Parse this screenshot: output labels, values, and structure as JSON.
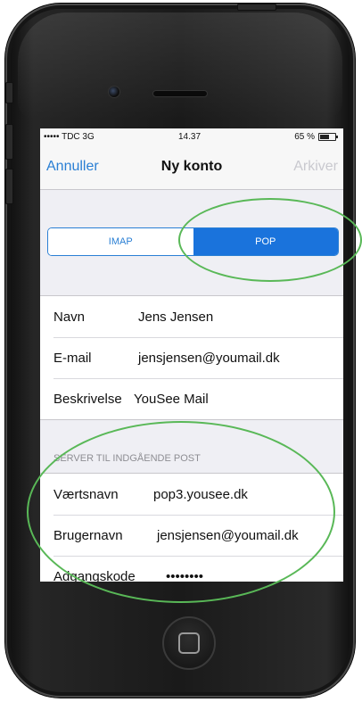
{
  "status_bar": {
    "carrier": "••••• TDC  3G",
    "time": "14.37",
    "battery_text": "65 %",
    "battery_level": 0.65
  },
  "nav": {
    "cancel": "Annuller",
    "title": "Ny konto",
    "save": "Arkiver"
  },
  "segmented": {
    "options": [
      "IMAP",
      "POP"
    ],
    "selected": "POP"
  },
  "account": [
    {
      "label": "Navn",
      "value": "Jens Jensen"
    },
    {
      "label": "E-mail",
      "value": "jensjensen@youmail.dk"
    },
    {
      "label": "Beskrivelse",
      "value": "YouSee Mail"
    }
  ],
  "incoming": {
    "header": "SERVER TIL INDGÅENDE POST",
    "rows": [
      {
        "label": "Værtsnavn",
        "value": "pop3.yousee.dk"
      },
      {
        "label": "Brugernavn",
        "value": "jensjensen@youmail.dk"
      },
      {
        "label": "Adgangskode",
        "value": "••••••••"
      }
    ]
  },
  "colors": {
    "accent": "#2a7fd4",
    "highlight": "#59b857"
  }
}
